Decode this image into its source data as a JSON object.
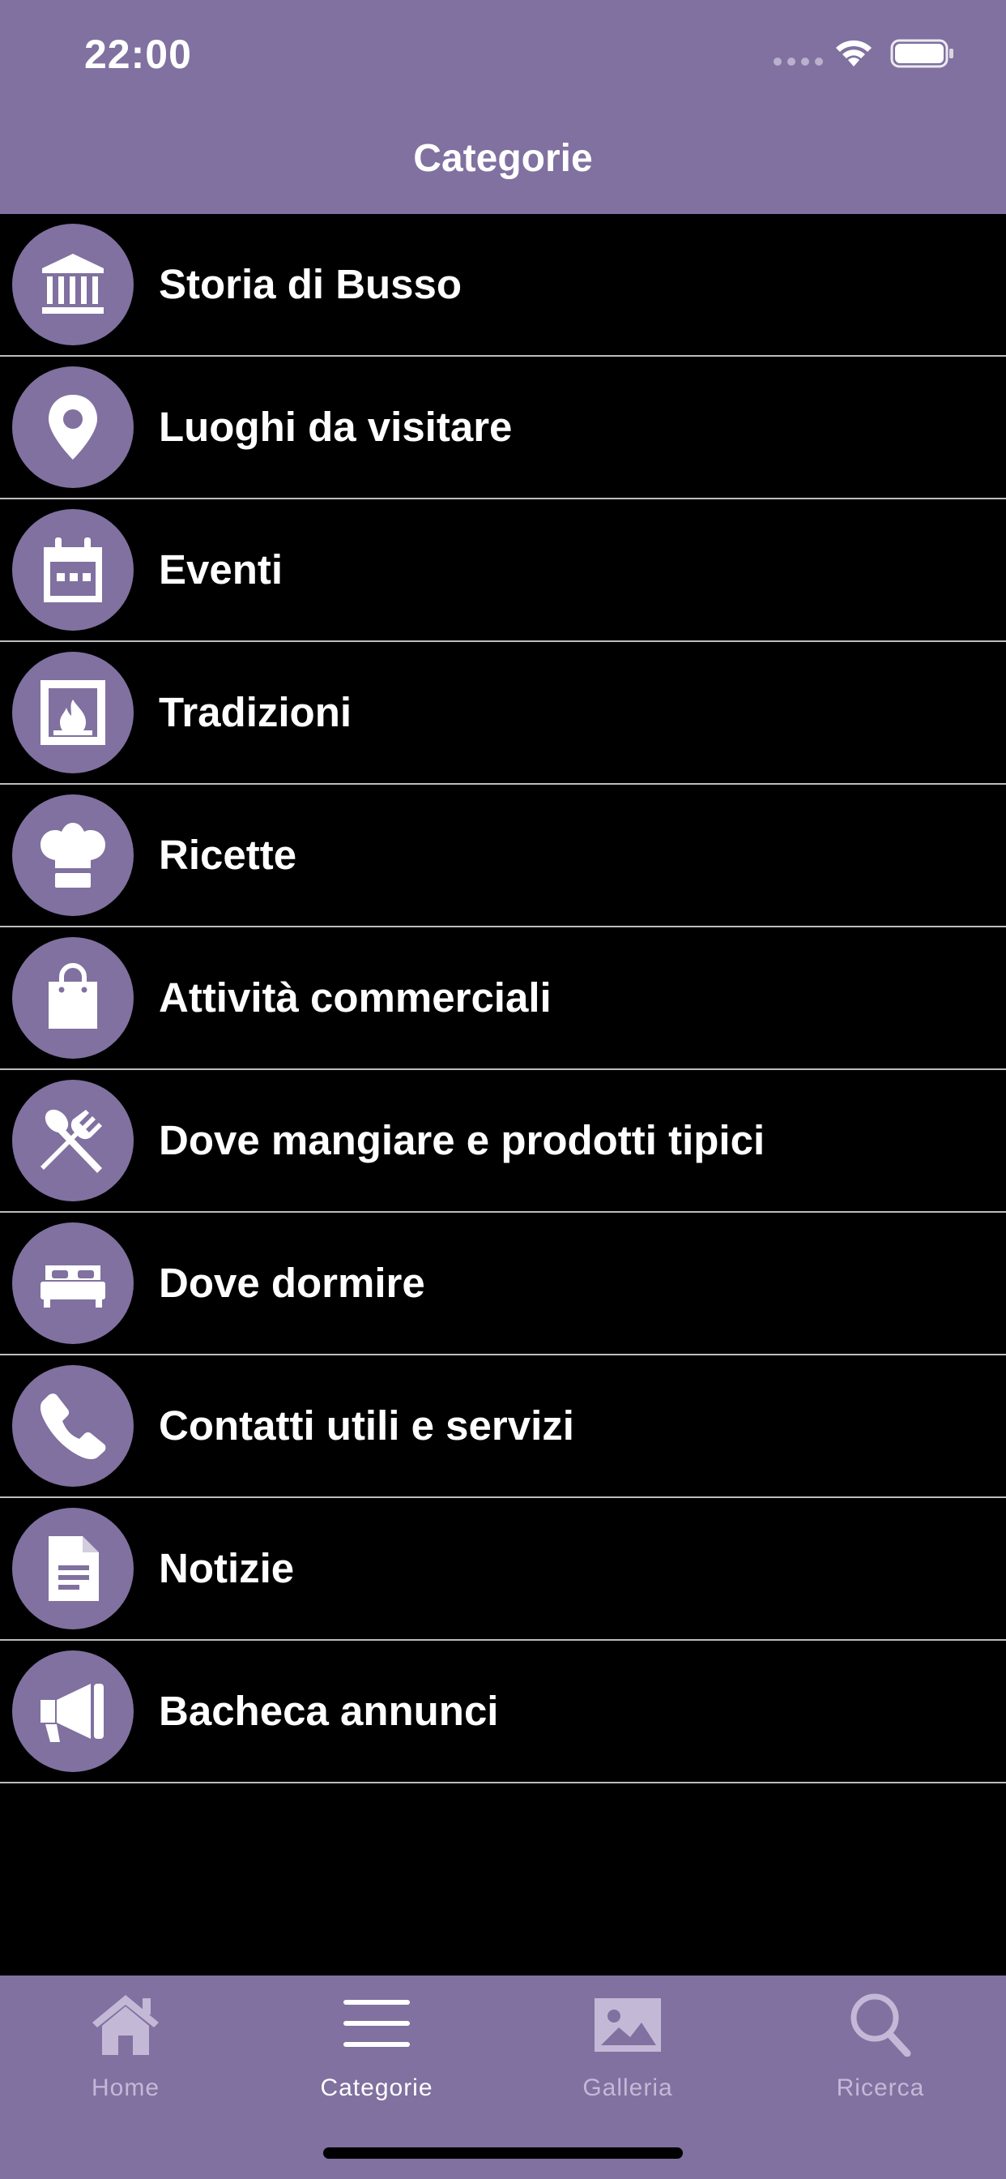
{
  "status_bar": {
    "time": "22:00"
  },
  "header": {
    "title": "Categorie"
  },
  "colors": {
    "accent": "#8071A0",
    "background": "#000000",
    "separator": "#bdbdbd",
    "inactive_tab": "#c3b9d7"
  },
  "categories": [
    {
      "label": "Storia di Busso",
      "icon": "museum-icon"
    },
    {
      "label": "Luoghi da visitare",
      "icon": "map-pin-icon"
    },
    {
      "label": "Eventi",
      "icon": "calendar-icon"
    },
    {
      "label": "Tradizioni",
      "icon": "fireplace-icon"
    },
    {
      "label": "Ricette",
      "icon": "chef-hat-icon"
    },
    {
      "label": "Attività commerciali",
      "icon": "shopping-bag-icon"
    },
    {
      "label": "Dove mangiare e prodotti tipici",
      "icon": "fork-spoon-icon"
    },
    {
      "label": "Dove dormire",
      "icon": "bed-icon"
    },
    {
      "label": "Contatti utili e servizi",
      "icon": "phone-icon"
    },
    {
      "label": "Notizie",
      "icon": "document-icon"
    },
    {
      "label": "Bacheca annunci",
      "icon": "megaphone-icon"
    }
  ],
  "tabs": [
    {
      "label": "Home",
      "icon": "house-icon",
      "active": false
    },
    {
      "label": "Categorie",
      "icon": "menu-lines-icon",
      "active": true
    },
    {
      "label": "Galleria",
      "icon": "image-icon",
      "active": false
    },
    {
      "label": "Ricerca",
      "icon": "magnifier-icon",
      "active": false
    }
  ]
}
